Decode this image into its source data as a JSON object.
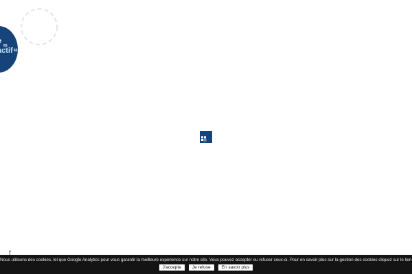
{
  "logo": {
    "line1": "e",
    "line1_sup": "65",
    "line2": "actif",
    "line2_sup": "65",
    "brand_color": "#16447a",
    "accent_color": "#bfe2f6"
  },
  "loader": {
    "icon": "loading-squares-icon",
    "color": "#16447a"
  },
  "social": {
    "facebook_label": "f"
  },
  "cookie_banner": {
    "message": "Nous utilisons des cookies, tel que Google Analytics pour vous garantir la meilleure experience sur notre site. Vous pouvez accepter ou refuser ceux-ci. Pour en savoir plus sur la gestion des cookies cliquez sur le lien \"En savoir plus\".",
    "accept_label": "J'accepte",
    "refuse_label": "Je refuse",
    "more_label": "En savoir plus",
    "background": "#141414"
  }
}
